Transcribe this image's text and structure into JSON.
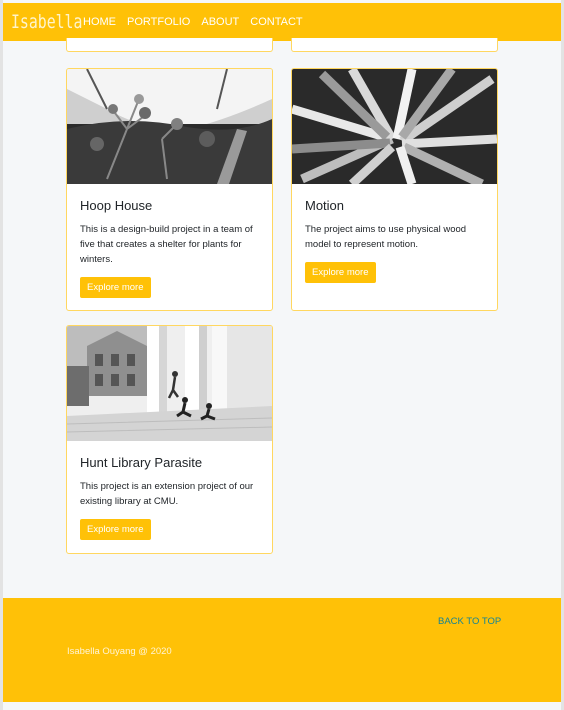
{
  "nav": {
    "brand": "Isabella",
    "links": [
      "HOME",
      "PORTFOLIO",
      "ABOUT",
      "CONTACT"
    ]
  },
  "cards": [
    {
      "title": "Hoop House",
      "text": "This is a design-build project in a team of five that creates a shelter for plants for winters.",
      "button": "Explore more"
    },
    {
      "title": "Motion",
      "text": "The project aims to use physical wood model to represent motion.",
      "button": "Explore more"
    },
    {
      "title": "Hunt Library Parasite",
      "text": "This project is an extension project of our existing library at CMU.",
      "button": "Explore more"
    }
  ],
  "footer": {
    "back_to_top": "BACK TO TOP",
    "copyright": "Isabella Ouyang @ 2020"
  },
  "colors": {
    "accent": "#ffc107",
    "link": "#138496",
    "background": "#f5f7f9"
  }
}
